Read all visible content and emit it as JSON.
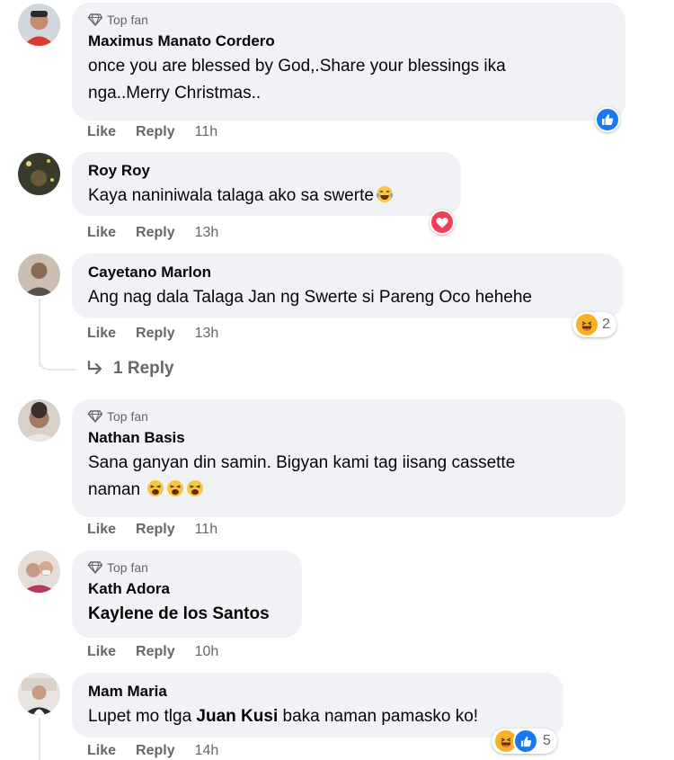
{
  "colors": {
    "bubble": "#f0f2f5",
    "secondary_text": "#65676b",
    "like_blue": "#1877f2",
    "love_red": "#f33e58",
    "haha_yellow": "#f7b125"
  },
  "labels": {
    "like": "Like",
    "reply": "Reply",
    "top_fan": "Top fan"
  },
  "comments": [
    {
      "author": "Maximus Manato Cordero",
      "top_fan": true,
      "text": "once you are blessed by God,.Share your blessings ika nga..Merry Christmas..",
      "time": "11h",
      "reactions": [
        "like-icon"
      ],
      "reaction_count": ""
    },
    {
      "author": "Roy Roy",
      "top_fan": false,
      "text": "Kaya naniniwala talaga ako sa swerte",
      "text_emoji": "tears-of-joy-emoji",
      "time": "13h",
      "reactions": [
        "love-icon"
      ],
      "reaction_count": ""
    },
    {
      "author": "Cayetano Marlon",
      "top_fan": false,
      "text": "Ang nag dala Talaga Jan ng Swerte si Pareng Oco hehehe",
      "time": "13h",
      "reactions": [
        "haha-icon"
      ],
      "reaction_count": "2",
      "replies_label": "1 Reply"
    },
    {
      "author": "Nathan Basis",
      "top_fan": true,
      "text_line1": "Sana ganyan din samin. Bigyan kami tag iisang cassette",
      "text_line2": "naman",
      "text_emojis": [
        "weary-face-emoji",
        "weary-face-emoji",
        "weary-face-emoji"
      ],
      "time": "11h"
    },
    {
      "author": "Kath Adora",
      "top_fan": true,
      "mention": "Kaylene de los Santos",
      "time": "10h"
    },
    {
      "author": "Mam Maria",
      "top_fan": false,
      "text_before": "Lupet mo tlga ",
      "mention": "Juan Kusi",
      "text_after": " baka naman pamasko ko!",
      "time": "14h",
      "reactions": [
        "haha-icon",
        "like-icon"
      ],
      "reaction_count": "5"
    }
  ]
}
